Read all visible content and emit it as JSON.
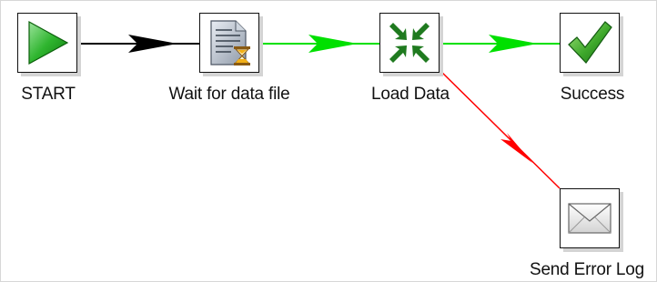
{
  "steps": {
    "start": {
      "label": "START",
      "icon": "play-icon"
    },
    "wait": {
      "label": "Wait for data file",
      "icon": "document-hourglass-icon"
    },
    "load": {
      "label": "Load Data",
      "icon": "compress-arrows-icon"
    },
    "success": {
      "label": "Success",
      "icon": "checkmark-icon"
    },
    "error": {
      "label": "Send Error Log",
      "icon": "envelope-icon"
    }
  },
  "hops": [
    {
      "from": "START",
      "to": "Wait for data file",
      "type": "unconditional",
      "color": "#000000"
    },
    {
      "from": "Wait for data file",
      "to": "Load Data",
      "type": "on-success",
      "color": "#00e000"
    },
    {
      "from": "Load Data",
      "to": "Success",
      "type": "on-success",
      "color": "#00e000"
    },
    {
      "from": "Load Data",
      "to": "Send Error Log",
      "type": "on-failure",
      "color": "#ff0000"
    }
  ],
  "colors": {
    "unconditional": "#000000",
    "success": "#00e000",
    "failure": "#ff0000"
  }
}
